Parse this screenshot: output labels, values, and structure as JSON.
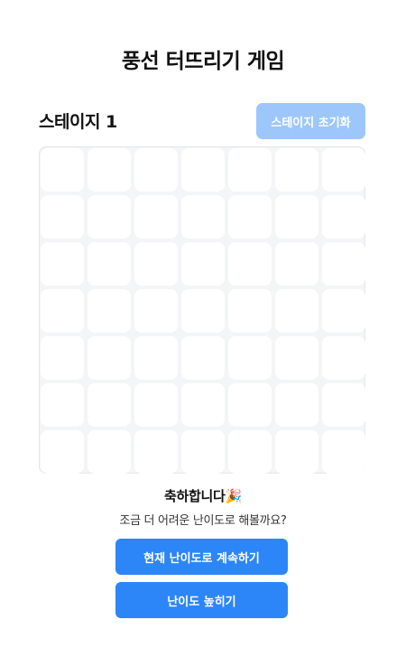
{
  "title": "풍선 터뜨리기 게임",
  "stage": {
    "label": "스테이지 1",
    "reset_label": "스테이지 초기화"
  },
  "board": {
    "rows": 7,
    "columns": 7,
    "balloons_remaining": 0
  },
  "result": {
    "heading": "축하합니다🎉",
    "message": "조금 더 어려운 난이도로 해볼까요?",
    "continue_label": "현재 난이도로 계속하기",
    "harder_label": "난이도 높히기"
  },
  "colors": {
    "primary": "#2d86f7",
    "primary_disabled": "#9dc7fb",
    "board_background": "#f4f5f7",
    "cell": "#ffffff"
  }
}
